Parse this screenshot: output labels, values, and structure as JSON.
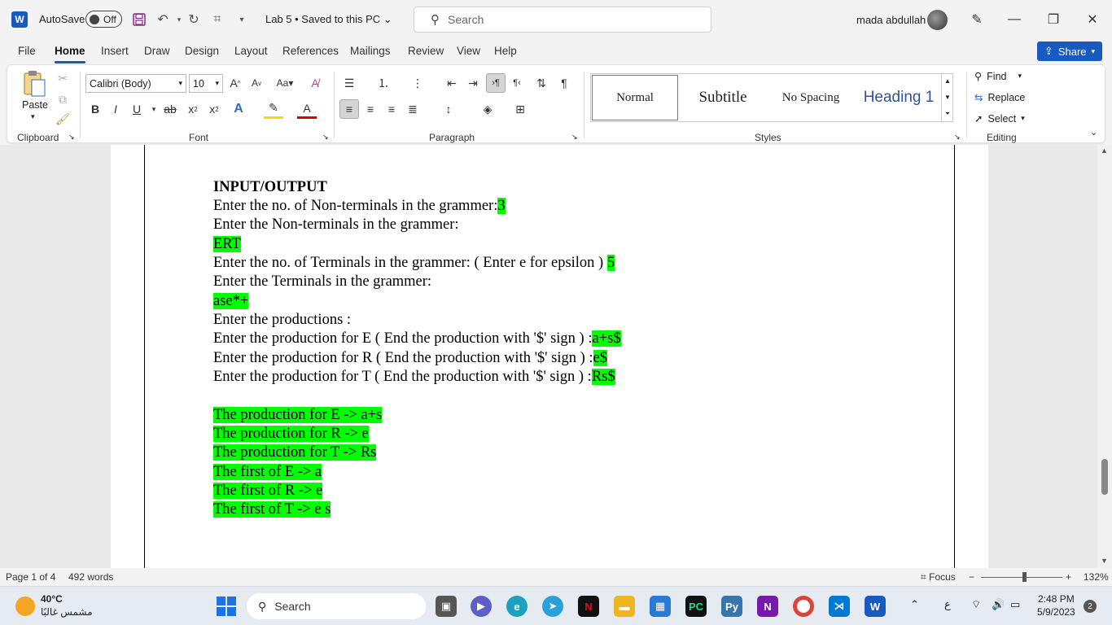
{
  "titlebar": {
    "app_letter": "W",
    "autosave_label": "AutoSave",
    "autosave_state": "Off",
    "doc_title": "Lab 5 • Saved to this PC",
    "search_placeholder": "Search",
    "user_name": "mada abdullah"
  },
  "tabs": [
    "File",
    "Home",
    "Insert",
    "Draw",
    "Design",
    "Layout",
    "References",
    "Mailings",
    "Review",
    "View",
    "Help"
  ],
  "share_label": "Share",
  "ribbon": {
    "clipboard": {
      "paste_label": "Paste",
      "group_label": "Clipboard"
    },
    "font": {
      "font_name": "Calibri (Body)",
      "font_size": "10",
      "group_label": "Font"
    },
    "paragraph": {
      "group_label": "Paragraph"
    },
    "styles": {
      "group_label": "Styles",
      "items": [
        "Normal",
        "Subtitle",
        "No Spacing",
        "Heading 1"
      ]
    },
    "editing": {
      "group_label": "Editing",
      "find": "Find",
      "replace": "Replace",
      "select": "Select"
    }
  },
  "document": {
    "heading": "INPUT/OUTPUT",
    "lines": [
      {
        "text": "Enter the no. of Non-terminals in the grammer:",
        "hl": "3"
      },
      {
        "text": "Enter the Non-terminals in the grammer:",
        "hl": ""
      },
      {
        "text": "",
        "hl": "ERT"
      },
      {
        "text": "Enter the no. of Terminals in the grammer: ( Enter e for epsilon ) ",
        "hl": "5"
      },
      {
        "text": "Enter the Terminals in the grammer:",
        "hl": ""
      },
      {
        "text": "",
        "hl": "ase*+"
      },
      {
        "text": "Enter the productions :",
        "hl": ""
      },
      {
        "text": "Enter the production for E ( End the production with '$' sign ) :",
        "hl": "a+s$"
      },
      {
        "text": "Enter the production for R ( End the production with '$' sign ) :",
        "hl": "e$"
      },
      {
        "text": "Enter the production for T ( End the production with '$' sign ) :",
        "hl": "Rs$"
      }
    ],
    "results": [
      "The production for E -> a+s",
      "The production for R -> e",
      "The production for T -> Rs",
      "The first of E -> a",
      "The first of R -> e",
      "The first of T -> e s"
    ]
  },
  "statusbar": {
    "page": "Page 1 of 4",
    "words": "492 words",
    "focus": "Focus",
    "zoom": "132%"
  },
  "taskbar": {
    "weather_temp": "40°C",
    "weather_desc": "مشمس غالبًا",
    "search_label": "Search",
    "lang": "ع",
    "time": "2:48 PM",
    "date": "5/9/2023",
    "notif_count": "2"
  },
  "colors": {
    "accent": "#185abd",
    "highlight": "#00ff00"
  }
}
